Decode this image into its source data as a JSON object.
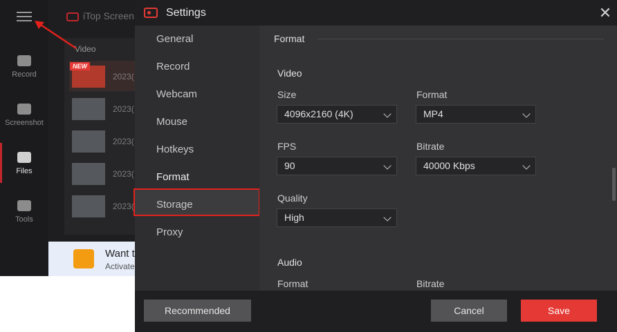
{
  "background_app": {
    "title": "iTop Screen",
    "rail": [
      {
        "label": "Record",
        "icon": "camera-icon"
      },
      {
        "label": "Screenshot",
        "icon": "camera-icon"
      },
      {
        "label": "Files",
        "icon": "folder-icon"
      },
      {
        "label": "Tools",
        "icon": "grid-icon"
      }
    ],
    "video_header": "Video",
    "new_badge": "NEW",
    "file_rows": [
      "2023(",
      "2023(",
      "2023(",
      "2023(",
      "2023("
    ],
    "promo_title": "Want t",
    "promo_sub": "Activate"
  },
  "dialog": {
    "title": "Settings",
    "close_label": "✕",
    "nav": [
      "General",
      "Record",
      "Webcam",
      "Mouse",
      "Hotkeys",
      "Format",
      "Storage",
      "Proxy"
    ],
    "selected_nav": "Format",
    "section_title": "Format",
    "video": {
      "heading": "Video",
      "size_label": "Size",
      "size_value": "4096x2160 (4K)",
      "format_label": "Format",
      "format_value": "MP4",
      "fps_label": "FPS",
      "fps_value": "90",
      "bitrate_label": "Bitrate",
      "bitrate_value": "40000 Kbps",
      "quality_label": "Quality",
      "quality_value": "High"
    },
    "audio": {
      "heading": "Audio",
      "format_label": "Format",
      "bitrate_label": "Bitrate"
    },
    "buttons": {
      "recommended": "Recommended",
      "cancel": "Cancel",
      "save": "Save"
    }
  },
  "colors": {
    "accent": "#e53935",
    "dialog_bg": "#333335",
    "sidebar_bg": "#2e2e30",
    "title_bar": "#1f1f21"
  }
}
